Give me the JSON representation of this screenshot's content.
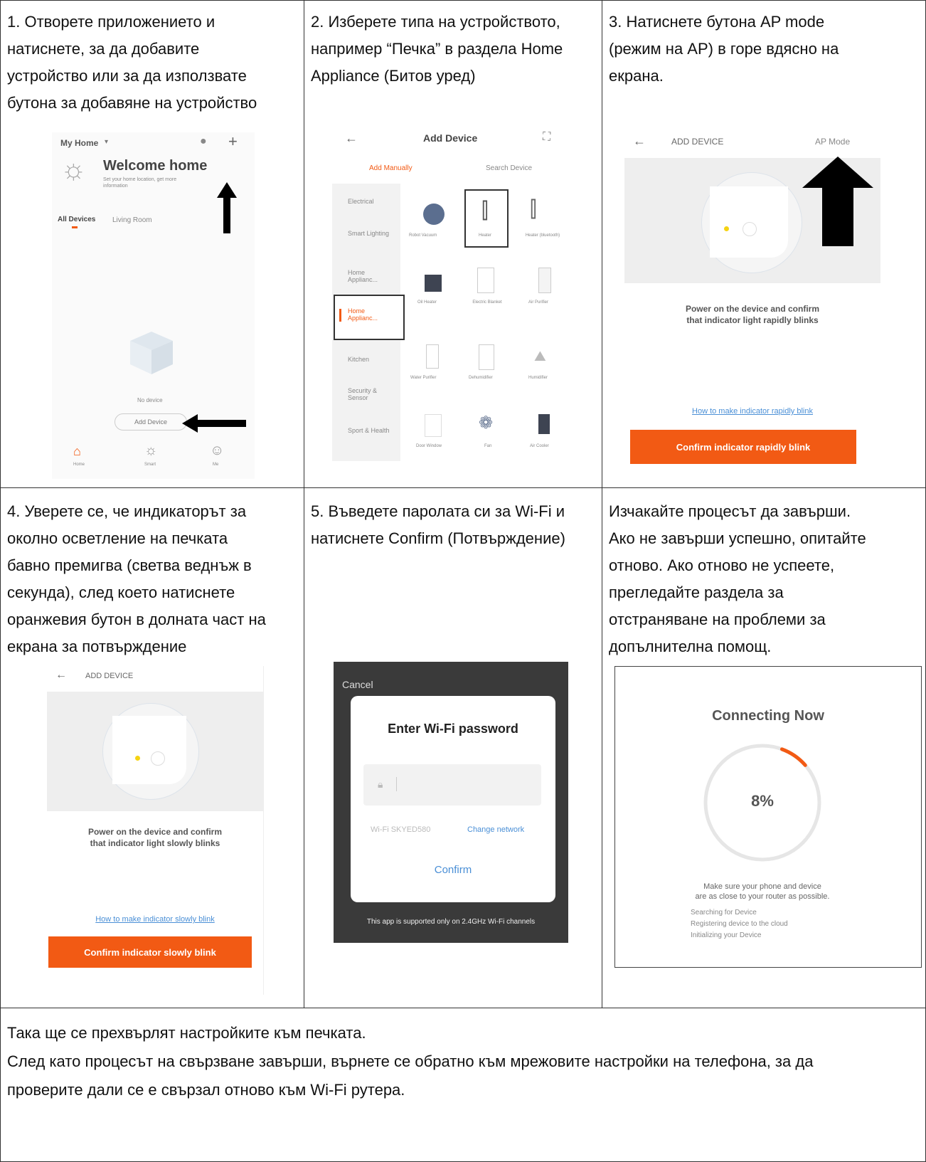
{
  "steps": {
    "s1": "1. Отворете приложението и\nнатиснете, за да добавите\nустройство или за да използвате\nбутона за добавяне на устройство",
    "s2": "2. Изберете типа на устройството,\nнапример “Печка” в раздела Home\nAppliance (Битов уред)",
    "s3": "3. Натиснете бутона AP mode\n(режим на AP) в горе вдясно на\nекрана.",
    "s4": "4. Уверете се, че индикаторът за\nоколно осветление на печката\nбавно премигва (светва веднъж в\nсекунда), след което натиснете\nоранжевия бутон в долната част на\nекрана за потвърждение",
    "s5": "5. Въведете паролата си за Wi-Fi и\nнатиснете Confirm (Потвърждение)",
    "s6": "  Изчакайте процесът да завърши.\nАко не завърши успешно, опитайте\nотново. Ако отново не успеете,\nпрегледайте раздела за\nотстраняване на проблеми за\nдопълнителна помощ.",
    "footer": "Така ще се прехвърлят настройките към печката.\nСлед като процесът на свързване завърши, върнете се обратно към мрежовите настройки на телефона, за да\nпроверите дали се е свързал отново към Wi-Fi рутера."
  },
  "screen1": {
    "home_title": "My Home",
    "welcome": "Welcome home",
    "welcome_sub": "Set your home location, get more information",
    "tab_all": "All Devices",
    "tab_living": "Living Room",
    "no_device": "No device",
    "add_device": "Add Device",
    "nav": [
      "Home",
      "Smart",
      "Me"
    ]
  },
  "screen2": {
    "title": "Add Device",
    "tab_manual": "Add Manually",
    "tab_search": "Search Device",
    "categories": [
      "Electrical",
      "Smart Lighting",
      "Home Applianc...",
      "Home Applianc...",
      "Kitchen",
      "Security & Sensor",
      "Sport & Health"
    ],
    "devices": [
      "Robot Vacuum",
      "Heater",
      "Heater (bluetooth)",
      "Oil Heater",
      "Electric Blanket",
      "Air Purifier",
      "Water Purifier",
      "Dehumidifier",
      "Humidifier",
      "Door Window",
      "Fan",
      "Air Cooler"
    ]
  },
  "screen3": {
    "title": "ADD DEVICE",
    "ap_mode": "AP Mode",
    "instruction": "Power on the device and confirm\nthat indicator light rapidly blinks",
    "link": "How to make indicator rapidly blink",
    "button": "Confirm indicator rapidly blink"
  },
  "screen4": {
    "title": "ADD DEVICE",
    "instruction": "Power on the device and confirm\nthat indicator light slowly blinks",
    "link": "How to make indicator slowly blink",
    "button": "Confirm indicator slowly blink"
  },
  "screen5": {
    "cancel": "Cancel",
    "title": "Enter Wi-Fi password",
    "ssid": "Wi-Fi SKYED580",
    "change": "Change network",
    "confirm": "Confirm",
    "note": "This app is supported only on 2.4GHz Wi-Fi channels"
  },
  "screen6": {
    "title": "Connecting Now",
    "percent": "8%",
    "progress": 0.08,
    "hint": "Make sure your phone and device\nare as close to your router as possible.",
    "steps": [
      "Searching for Device",
      "Registering device to the cloud",
      "Initializing your Device"
    ]
  },
  "colors": {
    "accent": "#f25a14",
    "link": "#4a8fd6"
  }
}
